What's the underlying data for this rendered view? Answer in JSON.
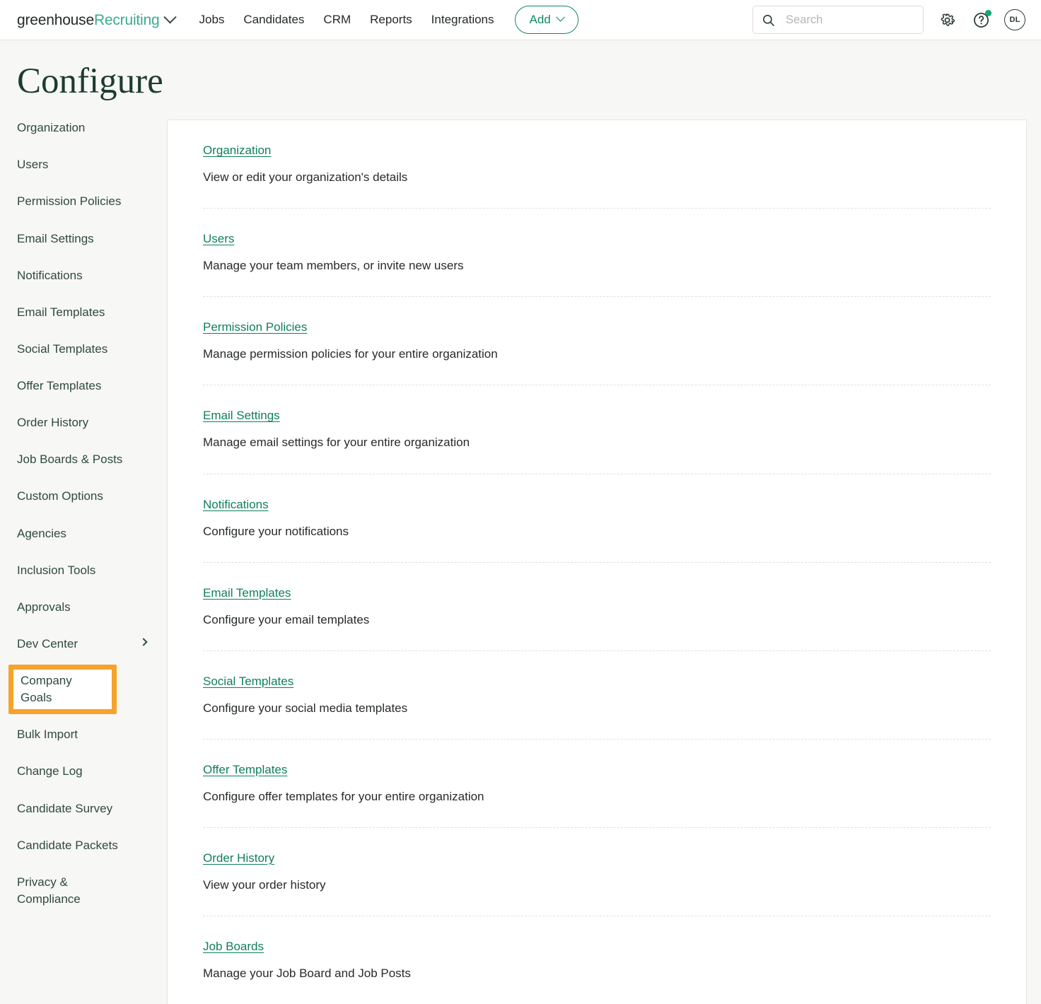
{
  "topbar": {
    "brand_primary": "greenhouse",
    "brand_secondary": "Recruiting",
    "brand_caret": "chevron-down-icon",
    "nav": [
      {
        "label": "Jobs"
      },
      {
        "label": "Candidates"
      },
      {
        "label": "CRM"
      },
      {
        "label": "Reports"
      },
      {
        "label": "Integrations"
      }
    ],
    "add_button": "Add",
    "search": {
      "placeholder": "Search",
      "value": ""
    },
    "settings_icon": "gear-icon",
    "help_icon": "question-mark-help-icon",
    "help_has_notification": true,
    "avatar_initials": "DL"
  },
  "page": {
    "title": "Configure"
  },
  "sidebar": {
    "items": [
      {
        "label": "Organization",
        "has_chevron": false,
        "highlighted": false
      },
      {
        "label": "Users",
        "has_chevron": false,
        "highlighted": false
      },
      {
        "label": "Permission Policies",
        "has_chevron": false,
        "highlighted": false
      },
      {
        "label": "Email Settings",
        "has_chevron": false,
        "highlighted": false
      },
      {
        "label": "Notifications",
        "has_chevron": false,
        "highlighted": false
      },
      {
        "label": "Email Templates",
        "has_chevron": false,
        "highlighted": false
      },
      {
        "label": "Social Templates",
        "has_chevron": false,
        "highlighted": false
      },
      {
        "label": "Offer Templates",
        "has_chevron": false,
        "highlighted": false
      },
      {
        "label": "Order History",
        "has_chevron": false,
        "highlighted": false
      },
      {
        "label": "Job Boards & Posts",
        "has_chevron": false,
        "highlighted": false
      },
      {
        "label": "Custom Options",
        "has_chevron": false,
        "highlighted": false
      },
      {
        "label": "Agencies",
        "has_chevron": false,
        "highlighted": false
      },
      {
        "label": "Inclusion Tools",
        "has_chevron": false,
        "highlighted": false
      },
      {
        "label": "Approvals",
        "has_chevron": false,
        "highlighted": false
      },
      {
        "label": "Dev Center",
        "has_chevron": true,
        "highlighted": false
      },
      {
        "label": "Company Goals",
        "has_chevron": false,
        "highlighted": true
      },
      {
        "label": "Bulk Import",
        "has_chevron": false,
        "highlighted": false
      },
      {
        "label": "Change Log",
        "has_chevron": false,
        "highlighted": false
      },
      {
        "label": "Candidate Survey",
        "has_chevron": false,
        "highlighted": false
      },
      {
        "label": "Candidate Packets",
        "has_chevron": false,
        "highlighted": false
      },
      {
        "label": "Privacy &\nCompliance",
        "has_chevron": false,
        "highlighted": false
      }
    ]
  },
  "main": {
    "rows": [
      {
        "link": "Organization",
        "description": "View or edit your organization's details"
      },
      {
        "link": "Users",
        "description": "Manage your team members, or invite new users"
      },
      {
        "link": "Permission Policies",
        "description": "Manage permission policies for your entire organization"
      },
      {
        "link": "Email Settings",
        "description": "Manage email settings for your entire organization"
      },
      {
        "link": "Notifications",
        "description": "Configure your notifications"
      },
      {
        "link": "Email Templates",
        "description": "Configure your email templates"
      },
      {
        "link": "Social Templates",
        "description": "Configure your social media templates"
      },
      {
        "link": "Offer Templates",
        "description": "Configure offer templates for your entire organization"
      },
      {
        "link": "Order History",
        "description": "View your order history"
      },
      {
        "link": "Job Boards",
        "description": "Manage your Job Board and Job Posts"
      }
    ]
  },
  "colors": {
    "brand_green": "#3aab8c",
    "link_green": "#0f7f5b",
    "title_green": "#1d3b31",
    "highlight_orange": "#f5a32a",
    "page_background": "#f7f7f6",
    "notification_dot": "#17a47a"
  }
}
